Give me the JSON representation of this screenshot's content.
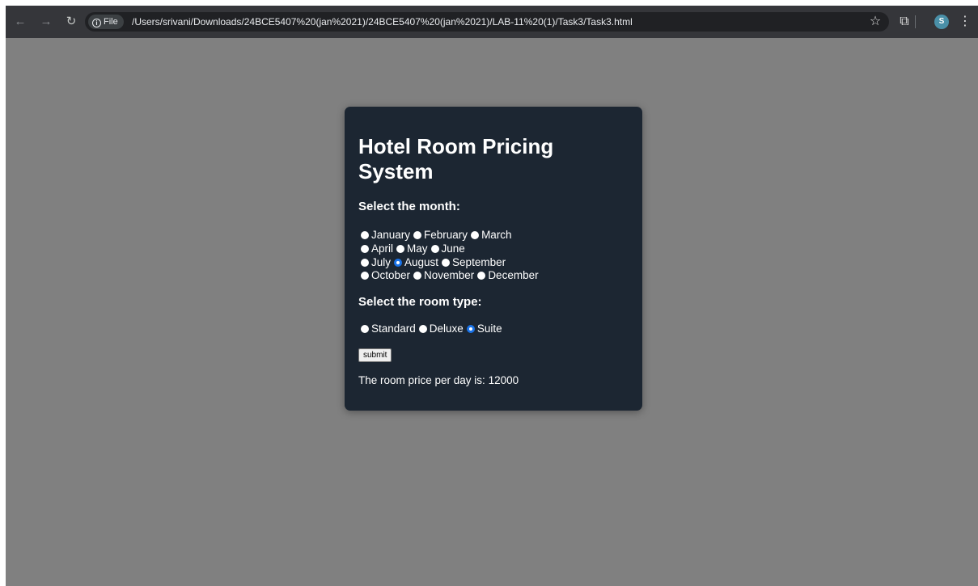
{
  "browser": {
    "url_chip": "File",
    "url": "/Users/srivani/Downloads/24BCE5407%20(jan%2021)/24BCE5407%20(jan%2021)/LAB-11%20(1)/Task3/Task3.html",
    "profile_initial": "S"
  },
  "form": {
    "title": "Hotel Room Pricing System",
    "month_label": "Select the month:",
    "months": [
      [
        "January",
        "February",
        "March"
      ],
      [
        "April",
        "May",
        "June"
      ],
      [
        "July",
        "August",
        "September"
      ],
      [
        "October",
        "November",
        "December"
      ]
    ],
    "selected_month": "August",
    "room_label": "Select the room type:",
    "room_types": [
      "Standard",
      "Deluxe",
      "Suite"
    ],
    "selected_room": "Suite",
    "submit_label": "submit",
    "result_text": "The room price per day is: 12000"
  },
  "colors": {
    "page_background": "#808080",
    "card_background": "#1c2632",
    "radio_selected": "#1a73e8"
  }
}
